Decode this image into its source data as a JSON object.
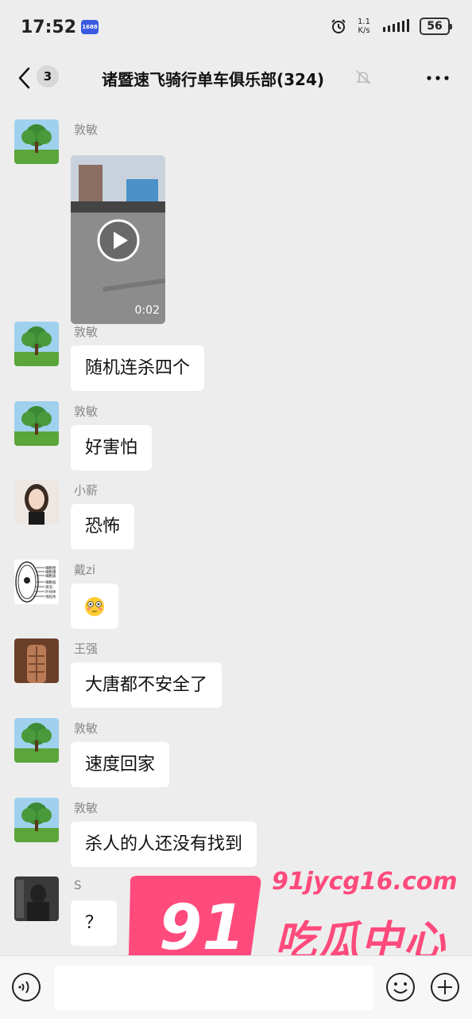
{
  "status_bar": {
    "time": "17:52",
    "app_badge": "1688",
    "net_speed_value": "1.1",
    "net_speed_unit": "K/s",
    "battery": "56"
  },
  "header": {
    "unread_count": "3",
    "title": "诸暨速飞骑行单车俱乐部(324)"
  },
  "messages": [
    {
      "sender": "敦敏",
      "type": "video",
      "duration": "0:02"
    },
    {
      "sender": "敦敏",
      "type": "text",
      "text": "随机连杀四个"
    },
    {
      "sender": "敦敏",
      "type": "text",
      "text": "好害怕"
    },
    {
      "sender": "小薪",
      "type": "text",
      "text": "恐怖"
    },
    {
      "sender": "戴zi",
      "type": "emoji",
      "text": "😳"
    },
    {
      "sender": "王强",
      "type": "text",
      "text": "大唐都不安全了"
    },
    {
      "sender": "敦敏",
      "type": "text",
      "text": "速度回家"
    },
    {
      "sender": "敦敏",
      "type": "text",
      "text": "杀人的人还没有找到"
    },
    {
      "sender": "S",
      "type": "text",
      "text": "？"
    }
  ],
  "avatar_labels": {
    "cell_diagram": [
      "细胞壁",
      "细胞膜",
      "细胞质",
      "细胞核",
      "液泡",
      "叶绿体",
      "线粒体"
    ]
  },
  "watermark": {
    "number": "91",
    "url": "91jycg16.com",
    "name": "吃瓜中心"
  },
  "colors": {
    "background": "#ededed",
    "bubble": "#ffffff",
    "watermark": "#ff4a7c"
  }
}
